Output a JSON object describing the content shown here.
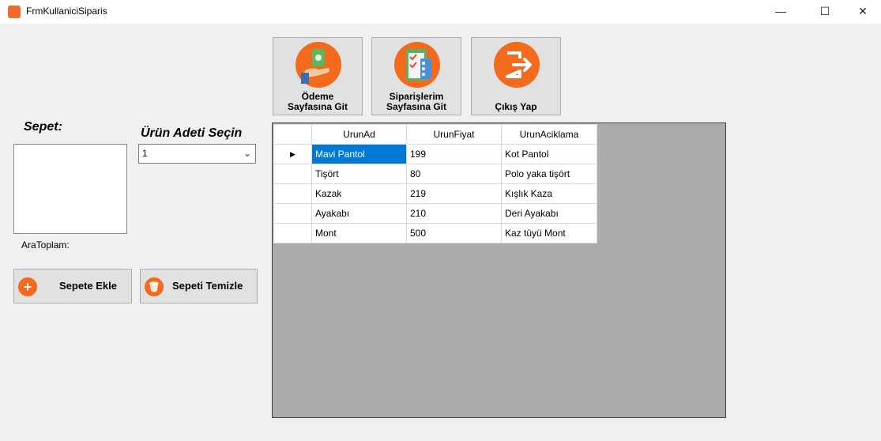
{
  "window": {
    "title": "FrmKullaniciSiparis",
    "minimize": "—",
    "maximize": "☐",
    "close": "✕"
  },
  "top_buttons": [
    {
      "label_line1": "Ödeme",
      "label_line2": "Sayfasına Git",
      "icon": "money-hand-icon"
    },
    {
      "label_line1": "Siparişlerim",
      "label_line2": "Sayfasına Git",
      "icon": "clipboard-list-icon"
    },
    {
      "label_line1": "Çıkış Yap",
      "icon": "logout-icon"
    }
  ],
  "left": {
    "sepet_label": "Sepet:",
    "ara_toplam_label": "AraToplam:",
    "add_button": "Sepete Ekle",
    "clear_button": "Sepeti Temizle"
  },
  "quantity": {
    "label": "Ürün Adeti Seçin",
    "value": "1"
  },
  "grid": {
    "columns": [
      "UrunAd",
      "UrunFiyat",
      "UrunAciklama"
    ],
    "rows": [
      [
        "Mavi Pantol",
        "199",
        "Kot Pantol"
      ],
      [
        "Tişört",
        "80",
        "Polo yaka tişört"
      ],
      [
        "Kazak",
        "219",
        "Kışlık Kaza"
      ],
      [
        "Ayakabı",
        "210",
        "Deri Ayakabı"
      ],
      [
        "Mont",
        "500",
        "Kaz tüyü Mont"
      ]
    ],
    "current_row_marker": "▶"
  },
  "colors": {
    "accent": "#f26a1b",
    "selection": "#0078d7",
    "grid_bg": "#ababab"
  }
}
